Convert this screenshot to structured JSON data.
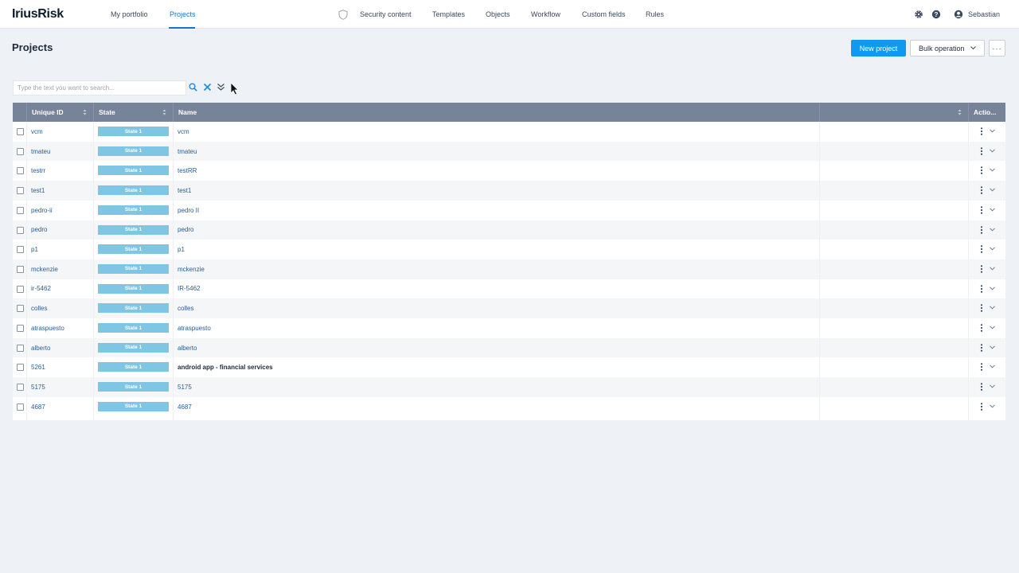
{
  "brand": "IriusRisk",
  "nav": {
    "left": [
      {
        "label": "My portfolio"
      },
      {
        "label": "Projects"
      }
    ],
    "center": [
      {
        "label": "Security content"
      },
      {
        "label": "Templates"
      },
      {
        "label": "Objects"
      },
      {
        "label": "Workflow"
      },
      {
        "label": "Custom fields"
      },
      {
        "label": "Rules"
      }
    ],
    "user": "Sebastian"
  },
  "page": {
    "title": "Projects",
    "new_project": "New project",
    "bulk_operation": "Bulk operation",
    "more": "···"
  },
  "search": {
    "placeholder": "Type the text you want to search..."
  },
  "table": {
    "columns": [
      "Unique ID",
      "State",
      "Name",
      "",
      "Actio..."
    ],
    "rows": [
      {
        "id": "vcm",
        "state": "State 1",
        "name": "vcm"
      },
      {
        "id": "tmateu",
        "state": "State 1",
        "name": "tmateu"
      },
      {
        "id": "testrr",
        "state": "State 1",
        "name": "testRR"
      },
      {
        "id": "test1",
        "state": "State 1",
        "name": "test1"
      },
      {
        "id": "pedro-ii",
        "state": "State 1",
        "name": "pedro II"
      },
      {
        "id": "pedro",
        "state": "State 1",
        "name": "pedro"
      },
      {
        "id": "p1",
        "state": "State 1",
        "name": "p1"
      },
      {
        "id": "mckenzie",
        "state": "State 1",
        "name": "mckenzie"
      },
      {
        "id": "ir-5462",
        "state": "State 1",
        "name": "IR-5462"
      },
      {
        "id": "colles",
        "state": "State 1",
        "name": "colles"
      },
      {
        "id": "atraspuesto",
        "state": "State 1",
        "name": "atraspuesto"
      },
      {
        "id": "alberto",
        "state": "State 1",
        "name": "alberto"
      },
      {
        "id": "5261",
        "state": "State 1",
        "name": "android app - financial services",
        "bold": true
      },
      {
        "id": "5175",
        "state": "State 1",
        "name": "5175"
      },
      {
        "id": "4687",
        "state": "State 1",
        "name": "4687"
      }
    ]
  },
  "colors": {
    "accent": "#0f9af0",
    "header": "#778399",
    "state_badge": "#7fc6e4",
    "link": "#2a5d91"
  },
  "icons": [
    "shield-icon",
    "gear-icon",
    "help-icon",
    "user-icon",
    "search-icon",
    "clear-icon",
    "expand-filters-icon",
    "sort-icon",
    "kebab-icon",
    "chevron-down-icon"
  ]
}
